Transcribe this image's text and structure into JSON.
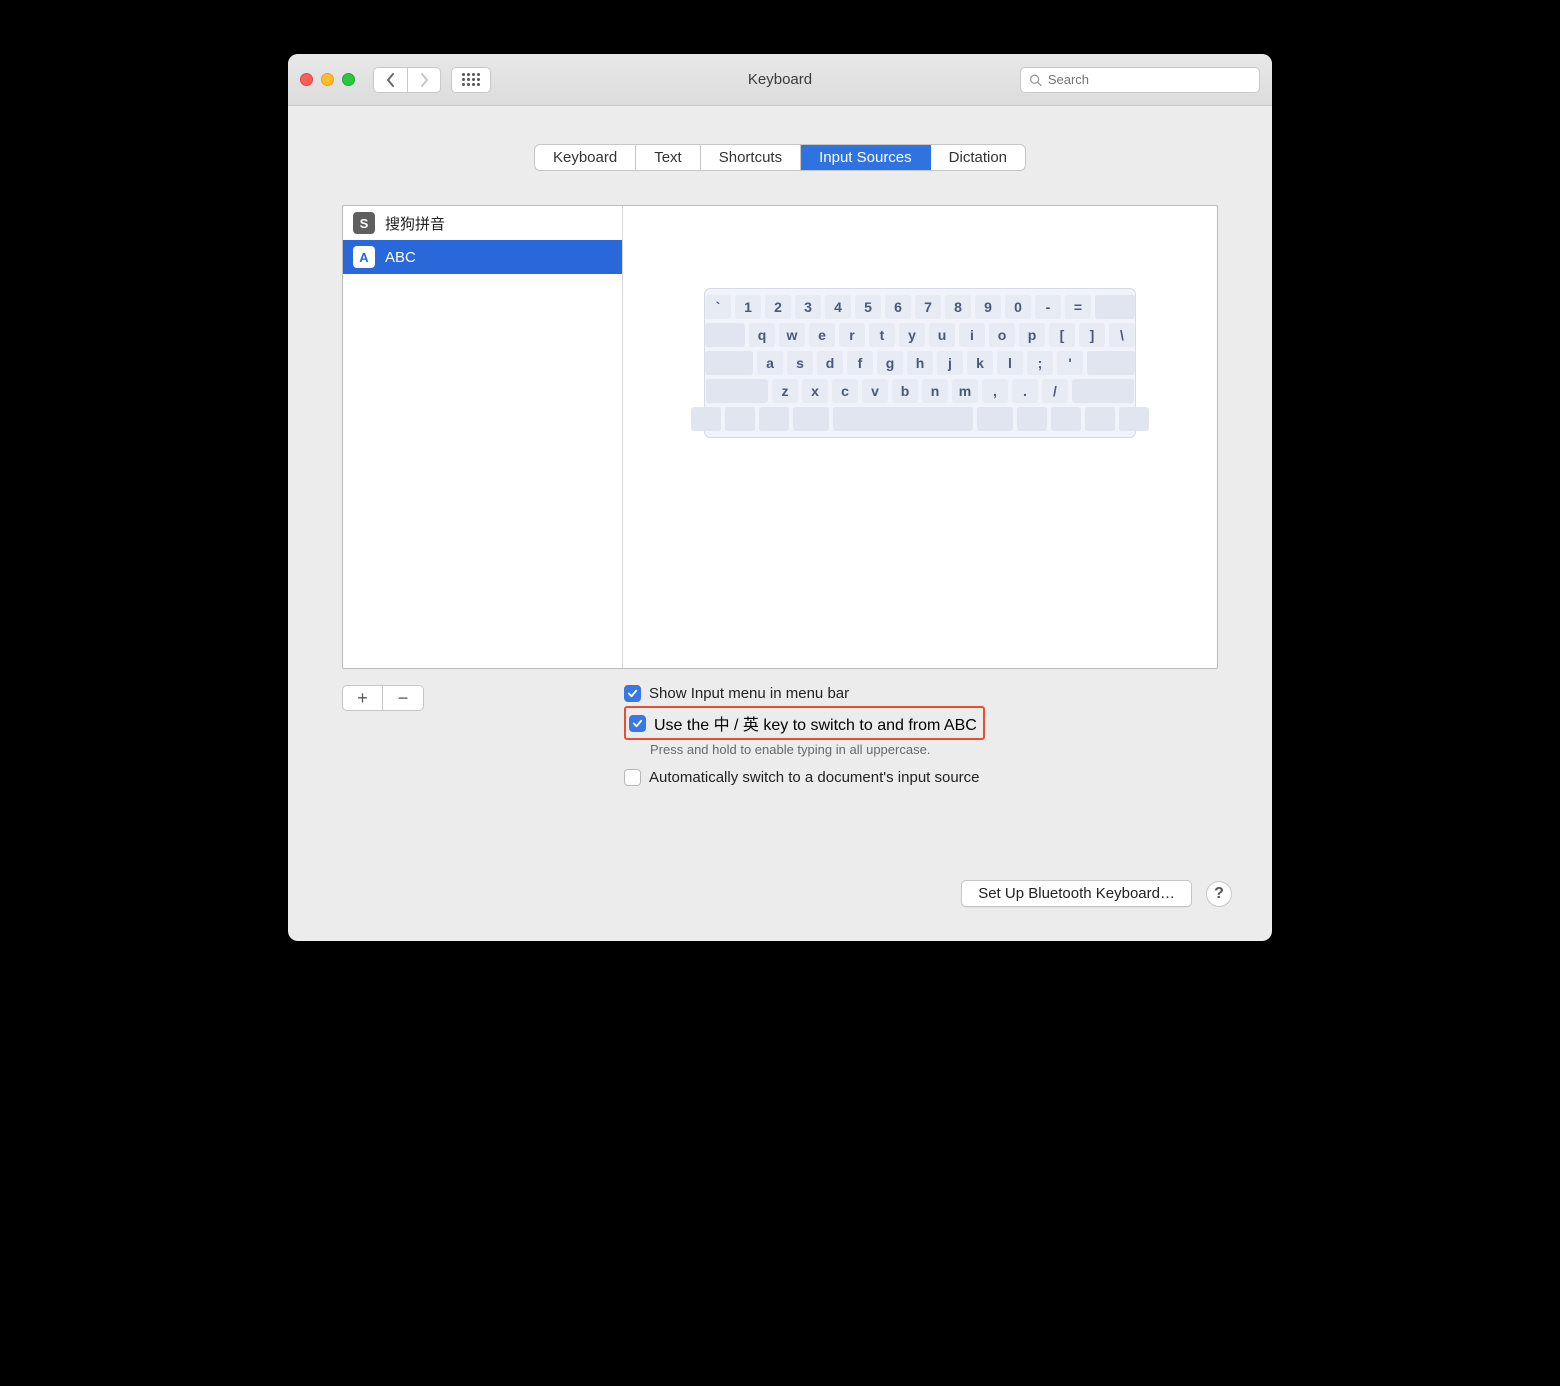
{
  "window": {
    "title": "Keyboard"
  },
  "search": {
    "placeholder": "Search"
  },
  "tabs": [
    {
      "label": "Keyboard"
    },
    {
      "label": "Text"
    },
    {
      "label": "Shortcuts"
    },
    {
      "label": "Input Sources",
      "active": true
    },
    {
      "label": "Dictation"
    }
  ],
  "sources": [
    {
      "icon": "S",
      "label": "搜狗拼音",
      "selected": false
    },
    {
      "icon": "A",
      "label": "ABC",
      "selected": true
    }
  ],
  "keyboard": {
    "row1": [
      "`",
      "1",
      "2",
      "3",
      "4",
      "5",
      "6",
      "7",
      "8",
      "9",
      "0",
      "-",
      "="
    ],
    "row2": [
      "q",
      "w",
      "e",
      "r",
      "t",
      "y",
      "u",
      "i",
      "o",
      "p",
      "[",
      "]",
      "\\"
    ],
    "row3": [
      "a",
      "s",
      "d",
      "f",
      "g",
      "h",
      "j",
      "k",
      "l",
      ";",
      "'"
    ],
    "row4": [
      "z",
      "x",
      "c",
      "v",
      "b",
      "n",
      "m",
      ",",
      ".",
      "/"
    ]
  },
  "buttons": {
    "add": "+",
    "remove": "−"
  },
  "checks": {
    "show_input_menu": {
      "label": "Show Input menu in menu bar",
      "checked": true
    },
    "use_switch_key": {
      "label": "Use the 中 / 英 key to switch to and from ABC",
      "checked": true,
      "hint": "Press and hold to enable typing in all uppercase."
    },
    "auto_switch": {
      "label": "Automatically switch to a document's input source",
      "checked": false
    }
  },
  "footer": {
    "bluetooth": "Set Up Bluetooth Keyboard…",
    "help": "?"
  }
}
